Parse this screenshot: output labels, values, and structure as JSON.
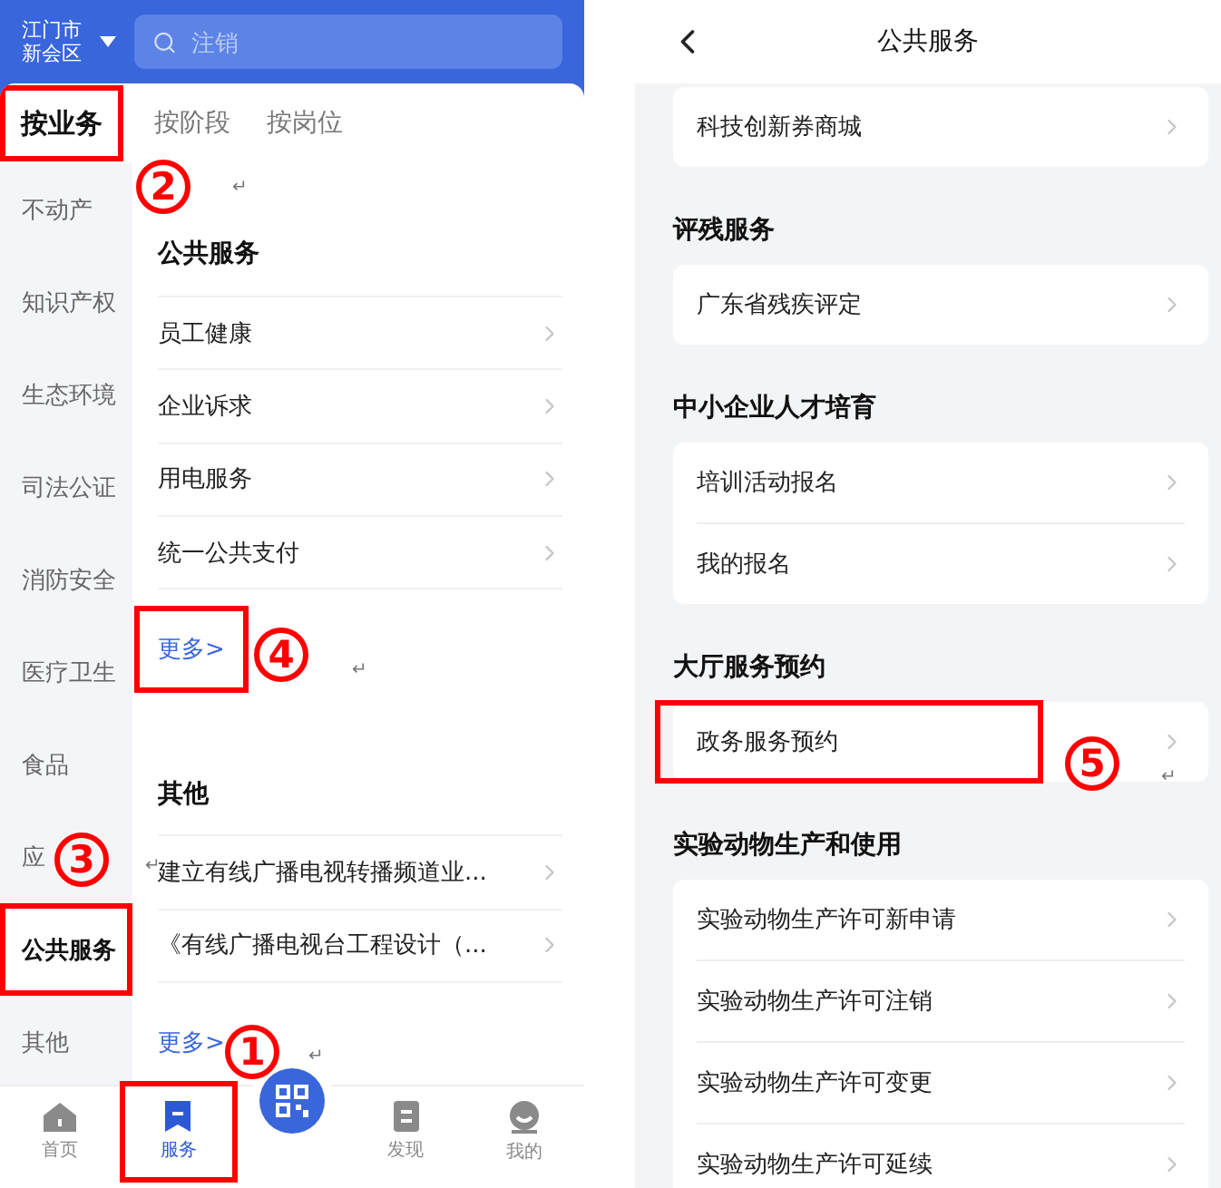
{
  "left_screen": {
    "location": [
      "江门市",
      "新会区"
    ],
    "search": {
      "placeholder": "注销"
    },
    "tabs": [
      {
        "label": "按业务",
        "selected": true,
        "highlighted": true
      },
      {
        "label": "按阶段",
        "selected": false,
        "highlighted": false
      },
      {
        "label": "按岗位",
        "selected": false,
        "highlighted": false
      }
    ],
    "sidebar": {
      "items": [
        {
          "label": "不动产",
          "selected": false,
          "highlighted": false
        },
        {
          "label": "知识产权",
          "selected": false,
          "highlighted": false
        },
        {
          "label": "生态环境",
          "selected": false,
          "highlighted": false
        },
        {
          "label": "司法公证",
          "selected": false,
          "highlighted": false
        },
        {
          "label": "消防安全",
          "selected": false,
          "highlighted": false
        },
        {
          "label": "医疗卫生",
          "selected": false,
          "highlighted": false
        },
        {
          "label": "食品",
          "selected": false,
          "highlighted": false
        },
        {
          "label": "应",
          "selected": false,
          "highlighted": false
        },
        {
          "label": "公共服务",
          "selected": true,
          "highlighted": true
        },
        {
          "label": "其他",
          "selected": false,
          "highlighted": false
        }
      ]
    },
    "sections": [
      {
        "title": "公共服务",
        "items": [
          "员工健康",
          "企业诉求",
          "用电服务",
          "统一公共支付"
        ],
        "more": {
          "label": "更多>",
          "highlighted": true
        }
      },
      {
        "title": "其他",
        "items": [
          "建立有线广播电视转播频道业...",
          "《有线广播电视台工程设计（..."
        ],
        "more": {
          "label": "更多>",
          "highlighted": false
        }
      }
    ],
    "bottom_nav": [
      {
        "kind": "home",
        "label": "首页",
        "selected": false,
        "highlighted": false
      },
      {
        "kind": "service",
        "label": "服务",
        "selected": true,
        "highlighted": true
      },
      {
        "kind": "scan"
      },
      {
        "kind": "discover",
        "label": "发现",
        "selected": false,
        "highlighted": false
      },
      {
        "kind": "profile",
        "label": "我的",
        "selected": false,
        "highlighted": false
      }
    ]
  },
  "right_screen": {
    "title": "公共服务",
    "groups": [
      {
        "items": [
          {
            "label": "科技创新券商城",
            "highlighted": false
          }
        ]
      },
      {
        "title": "评残服务",
        "items": [
          {
            "label": "广东省残疾评定",
            "highlighted": false
          }
        ]
      },
      {
        "title": "中小企业人才培育",
        "items": [
          {
            "label": "培训活动报名",
            "highlighted": false
          },
          {
            "label": "我的报名",
            "highlighted": false
          }
        ]
      },
      {
        "title": "大厅服务预约",
        "items": [
          {
            "label": "政务服务预约",
            "highlighted": true
          }
        ]
      },
      {
        "title": "实验动物生产和使用",
        "items": [
          {
            "label": "实验动物生产许可新申请",
            "highlighted": false
          },
          {
            "label": "实验动物生产许可注销",
            "highlighted": false
          },
          {
            "label": "实验动物生产许可变更",
            "highlighted": false
          },
          {
            "label": "实验动物生产许可延续",
            "highlighted": false
          }
        ]
      }
    ]
  },
  "annotations": [
    "1",
    "2",
    "3",
    "4",
    "5"
  ],
  "paragraph_marks": [
    "↵",
    "↵",
    "↵",
    "↵",
    "↵"
  ]
}
